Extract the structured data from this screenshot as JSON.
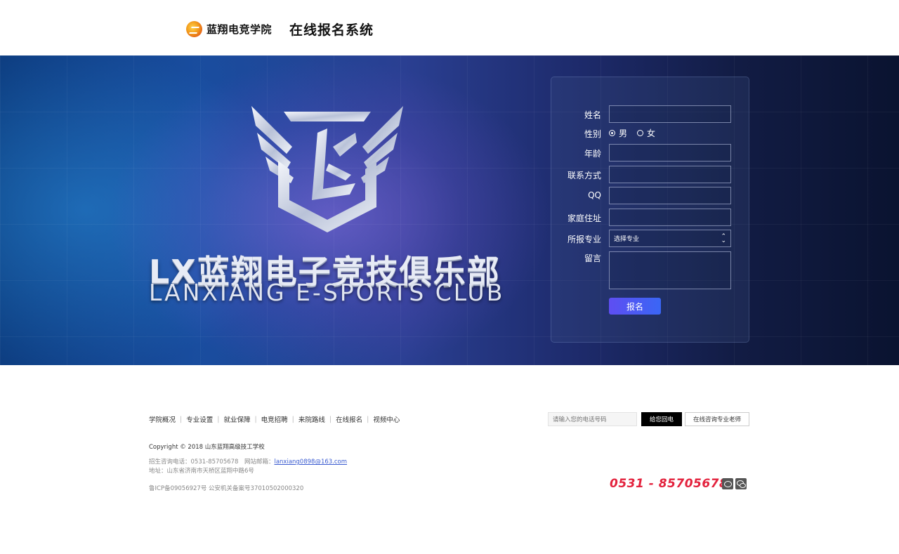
{
  "header": {
    "logo_text": "蓝翔电竞学院",
    "system_title": "在线报名系统"
  },
  "banner": {
    "club_name_cn": "LX蓝翔电子竞技俱乐部",
    "club_name_en": "LANXIANG E-SPORTS CLUB"
  },
  "form": {
    "name_label": "姓名",
    "gender_label": "性别",
    "gender_options": [
      "男",
      "女"
    ],
    "gender_selected": "男",
    "age_label": "年龄",
    "contact_label": "联系方式",
    "qq_label": "QQ",
    "address_label": "家庭住址",
    "major_label": "所报专业",
    "major_select_value": "选择专业",
    "message_label": "留言",
    "submit_label": "报名"
  },
  "footer": {
    "nav": [
      "学院概况",
      "专业设置",
      "就业保障",
      "电竞招聘",
      "来院路线",
      "在线报名",
      "视频中心"
    ],
    "phone_placeholder": "请输入您的电话号码",
    "callback_label": "给您回电",
    "consult_label": "在线咨询专业老师",
    "copyright": "Copyright © 2018 山东蓝翔高级技工学校",
    "hotline_line_prefix": "招生咨询电话：0531-85705678　网站邮箱：",
    "email": "lanxiang0898@163.com",
    "address": "地址：山东省济南市天桥区蓝翔中路6号",
    "icp": "鲁ICP备09056927号  公安机关备案号37010502000320",
    "hotline": "0531 - 85705678",
    "social_icons": [
      "weibo-icon",
      "wechat-icon"
    ]
  }
}
